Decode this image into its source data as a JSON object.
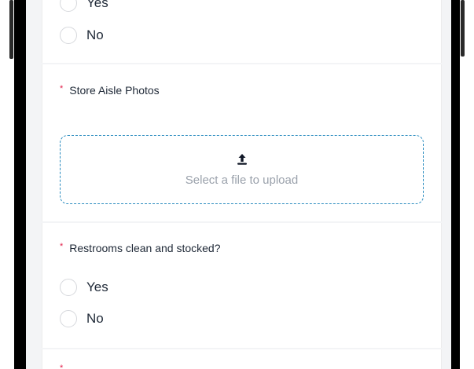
{
  "questions": {
    "previous": {
      "options": [
        "Yes",
        "No"
      ]
    },
    "store_aisle_photos": {
      "label": "Store Aisle Photos",
      "required_mark": "*",
      "upload_placeholder": "Select a file to upload"
    },
    "restrooms": {
      "label": "Restrooms clean and stocked?",
      "required_mark": "*",
      "options": [
        "Yes",
        "No"
      ]
    },
    "next": {
      "required_mark": "*"
    }
  },
  "colors": {
    "accent_dashed": "#2a8cbf",
    "required": "#e11d48",
    "frame": "#000000"
  },
  "icons": {
    "upload": "upload-arrow-icon"
  }
}
